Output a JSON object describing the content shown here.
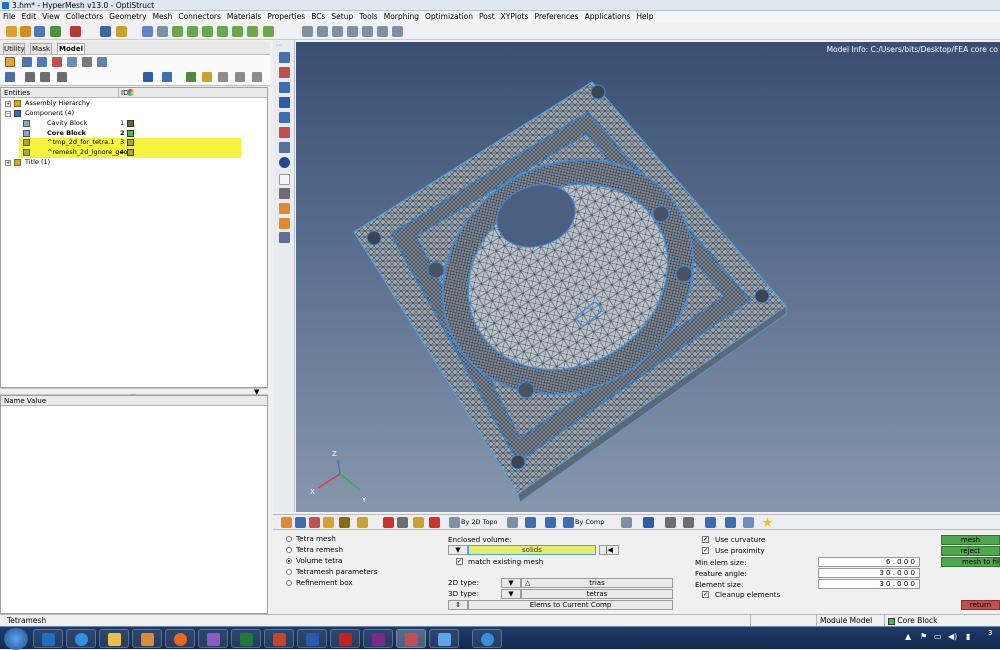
{
  "window": {
    "title": "3.hm* - HyperMesh v13.0 - OptiStruct"
  },
  "menu": [
    "File",
    "Edit",
    "View",
    "Collectors",
    "Geometry",
    "Mesh",
    "Connectors",
    "Materials",
    "Properties",
    "BCs",
    "Setup",
    "Tools",
    "Morphing",
    "Optimization",
    "Post",
    "XYPlots",
    "Preferences",
    "Applications",
    "Help"
  ],
  "left_tabs": [
    "Utility",
    "Mask",
    "Model"
  ],
  "browser": {
    "col_entities": "Entities",
    "col_id": "ID",
    "items": [
      {
        "label": "Assembly Hierarchy",
        "indent": 0,
        "id": "",
        "color": ""
      },
      {
        "label": "Component (4)",
        "indent": 0,
        "id": "",
        "color": ""
      },
      {
        "label": "Cavity Block",
        "indent": 1,
        "id": "1",
        "color": "#6b6b2e"
      },
      {
        "label": "Core Block",
        "indent": 1,
        "id": "2",
        "color": "#3fbf3f",
        "bold": true
      },
      {
        "label": "^tmp_2d_for_tetra.1",
        "indent": 1,
        "id": "3",
        "color": "#a8a83a",
        "highlight": true
      },
      {
        "label": "^remesh_2d_ignore_geom",
        "indent": 1,
        "id": "4",
        "color": "#a8a83a",
        "highlight": true
      },
      {
        "label": "Title (1)",
        "indent": 0,
        "id": "",
        "color": ""
      }
    ]
  },
  "props": {
    "header": "Name Value"
  },
  "viewport": {
    "model_info": "Model Info: C:/Users/bits/Desktop/FEA core co"
  },
  "bottombar": {
    "topo": "By 2D Topo",
    "comp": "By Comp"
  },
  "panel": {
    "options": [
      {
        "label": "Tetra mesh",
        "selected": false
      },
      {
        "label": "Tetra remesh",
        "selected": false
      },
      {
        "label": "Volume tetra",
        "selected": true
      },
      {
        "label": "Tetramesh parameters",
        "selected": false
      },
      {
        "label": "Refinement box",
        "selected": false
      }
    ],
    "enclosed_volume_label": "Enclosed volume:",
    "solids_label": "solids",
    "match_existing": "match existing mesh",
    "type2d_label": "2D type:",
    "type2d_value": "trias",
    "type3d_label": "3D type:",
    "type3d_value": "tetras",
    "elems_to_comp": "Elems to Current Comp",
    "use_curvature": "Use curvature",
    "use_proximity": "Use proximity",
    "min_elem_label": "Min elem size:",
    "min_elem_value": "6 . 0 0 0",
    "feature_angle_label": "Feature angle:",
    "feature_angle_value": "3 0 . 0 0 0",
    "elem_size_label": "Element size:",
    "elem_size_value": "3 0 . 0 0 0",
    "cleanup": "Cleanup elements",
    "btn_mesh": "mesh",
    "btn_reject": "reject",
    "btn_mesh_to_file": "mesh to file",
    "btn_return": "return"
  },
  "status": {
    "left": "Tetramesh",
    "module": "Module Model",
    "component": "Core Block"
  },
  "taskbar": {
    "clock": "3"
  },
  "colors": {
    "accent_green": "#4ea64e",
    "return_red": "#c0504d",
    "highlight_yellow": "#f4f43e"
  }
}
